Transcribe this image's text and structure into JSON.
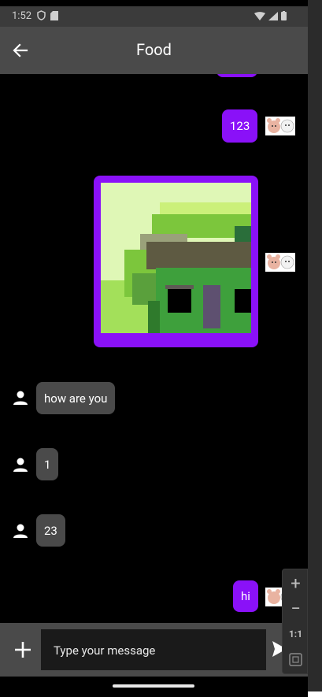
{
  "status_bar": {
    "time": "1:52"
  },
  "app_bar": {
    "title": "Food"
  },
  "messages": [
    {
      "type": "outgoing",
      "text": "123"
    },
    {
      "type": "outgoing-image"
    },
    {
      "type": "incoming",
      "text": "how are you"
    },
    {
      "type": "incoming",
      "text": "1"
    },
    {
      "type": "incoming",
      "text": "23"
    },
    {
      "type": "outgoing",
      "text": "hi"
    }
  ],
  "input": {
    "placeholder": "Type your message"
  },
  "zoom_controls": {
    "ratio_label": "1:1"
  },
  "colors": {
    "accent": "#8a11f8",
    "incoming_bubble": "#4a4a4a",
    "app_bar": "#4a4a4a",
    "background": "#000000"
  }
}
